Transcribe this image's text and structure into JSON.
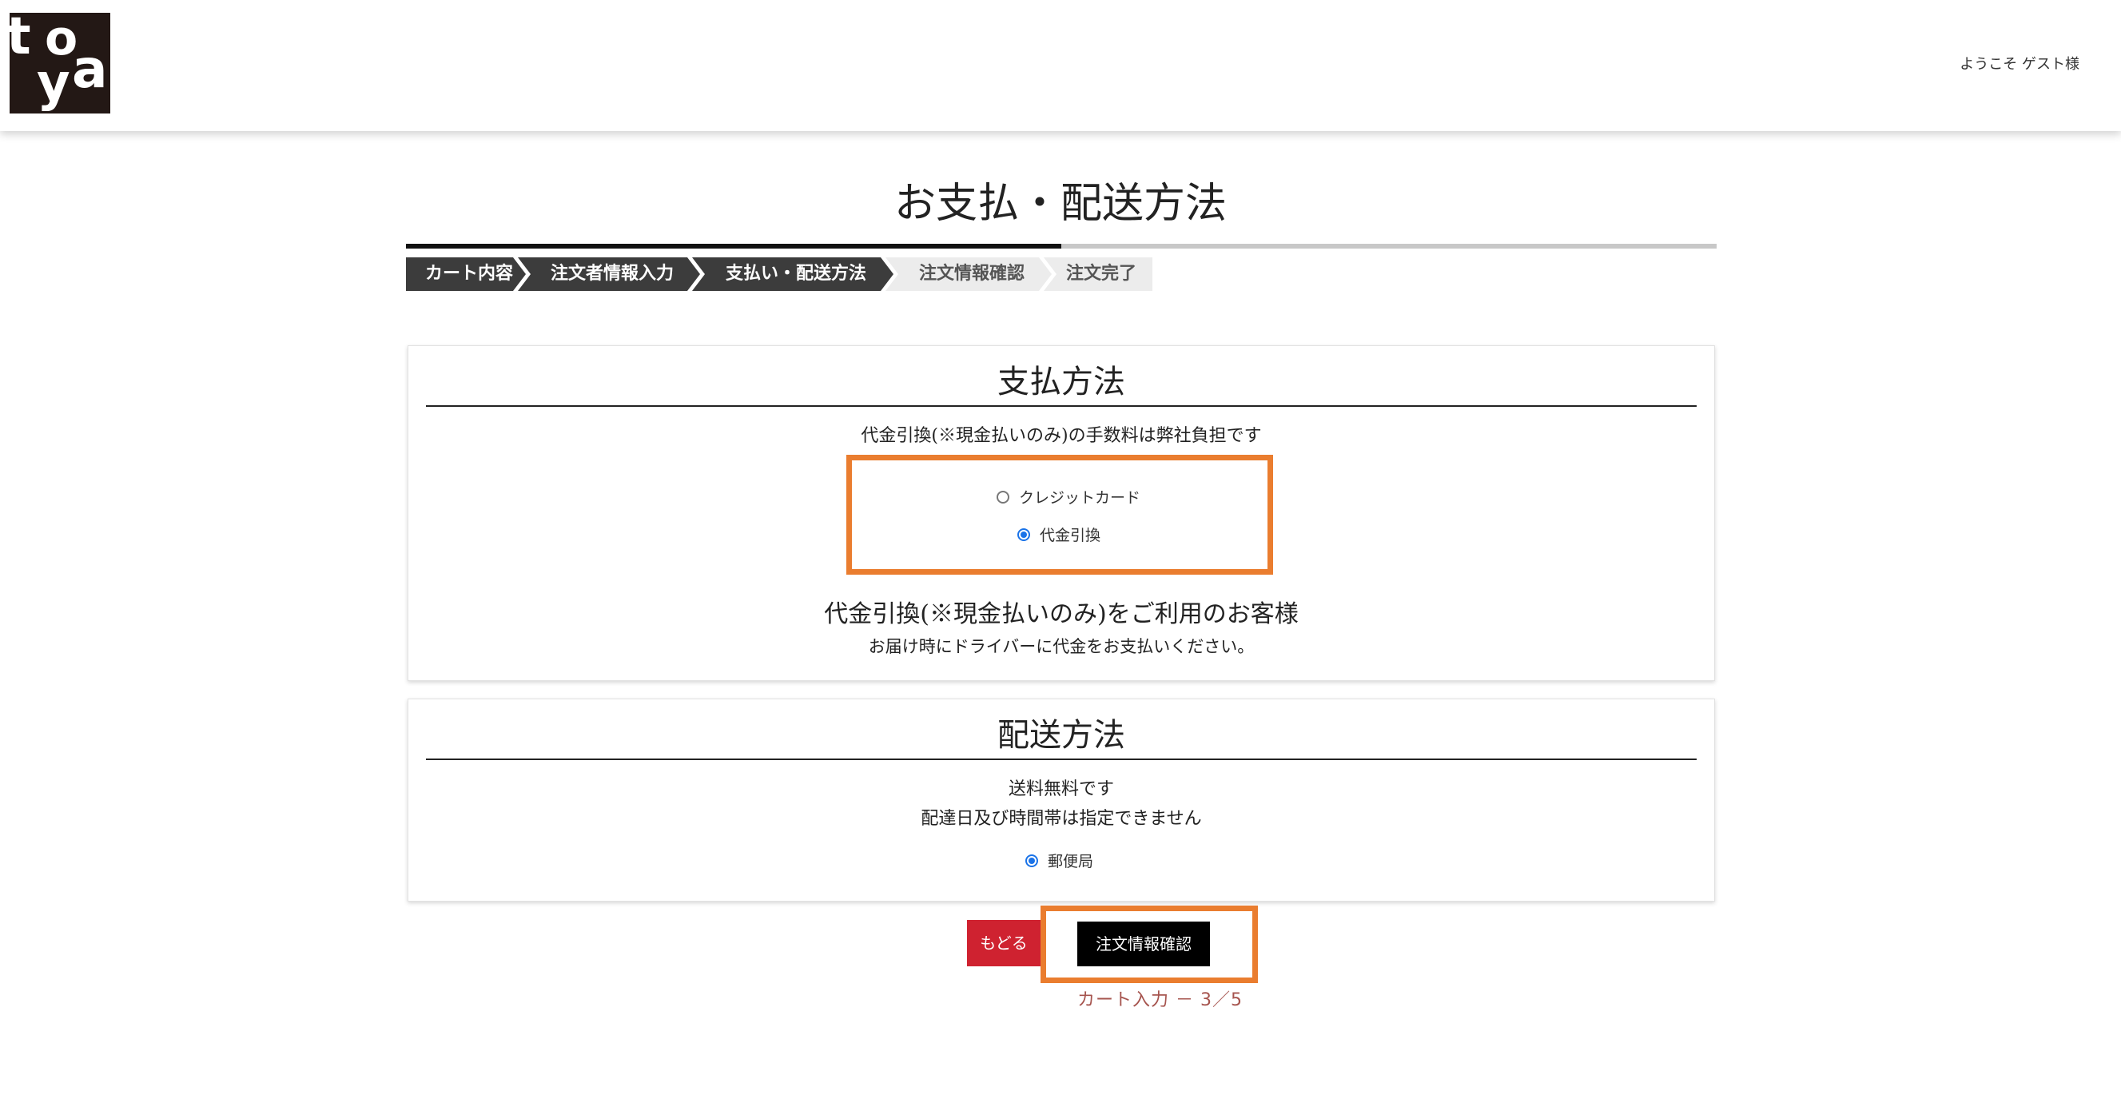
{
  "header": {
    "logo_letters": [
      "t",
      "o",
      "y",
      "a"
    ],
    "welcome_text": "ようこそ ゲスト様"
  },
  "page_title": "お支払・配送方法",
  "progress": {
    "completed_fraction": 0.5
  },
  "steps": [
    {
      "label": "カート内容",
      "state": "done"
    },
    {
      "label": "注文者情報入力",
      "state": "done"
    },
    {
      "label": "支払い・配送方法",
      "state": "current"
    },
    {
      "label": "注文情報確認",
      "state": "pending"
    },
    {
      "label": "注文完了",
      "state": "pending"
    }
  ],
  "payment": {
    "title": "支払方法",
    "note": "代金引換(※現金払いのみ)の手数料は弊社負担です",
    "options": [
      {
        "label": "クレジットカード",
        "checked": false
      },
      {
        "label": "代金引換",
        "checked": true
      }
    ],
    "cod_heading": "代金引換(※現金払いのみ)をご利用のお客様",
    "cod_description": "お届け時にドライバーに代金をお支払いください。"
  },
  "shipping": {
    "title": "配送方法",
    "note1": "送料無料です",
    "note2": "配達日及び時間帯は指定できません",
    "options": [
      {
        "label": "郵便局",
        "checked": true
      }
    ]
  },
  "buttons": {
    "back": "もどる",
    "next": "注文情報確認"
  },
  "step_counter": "カート入力 － 3／5",
  "colors": {
    "highlight": "#ea7d2f",
    "back_button": "#cf2230",
    "radio_checked": "#1a73e8"
  }
}
